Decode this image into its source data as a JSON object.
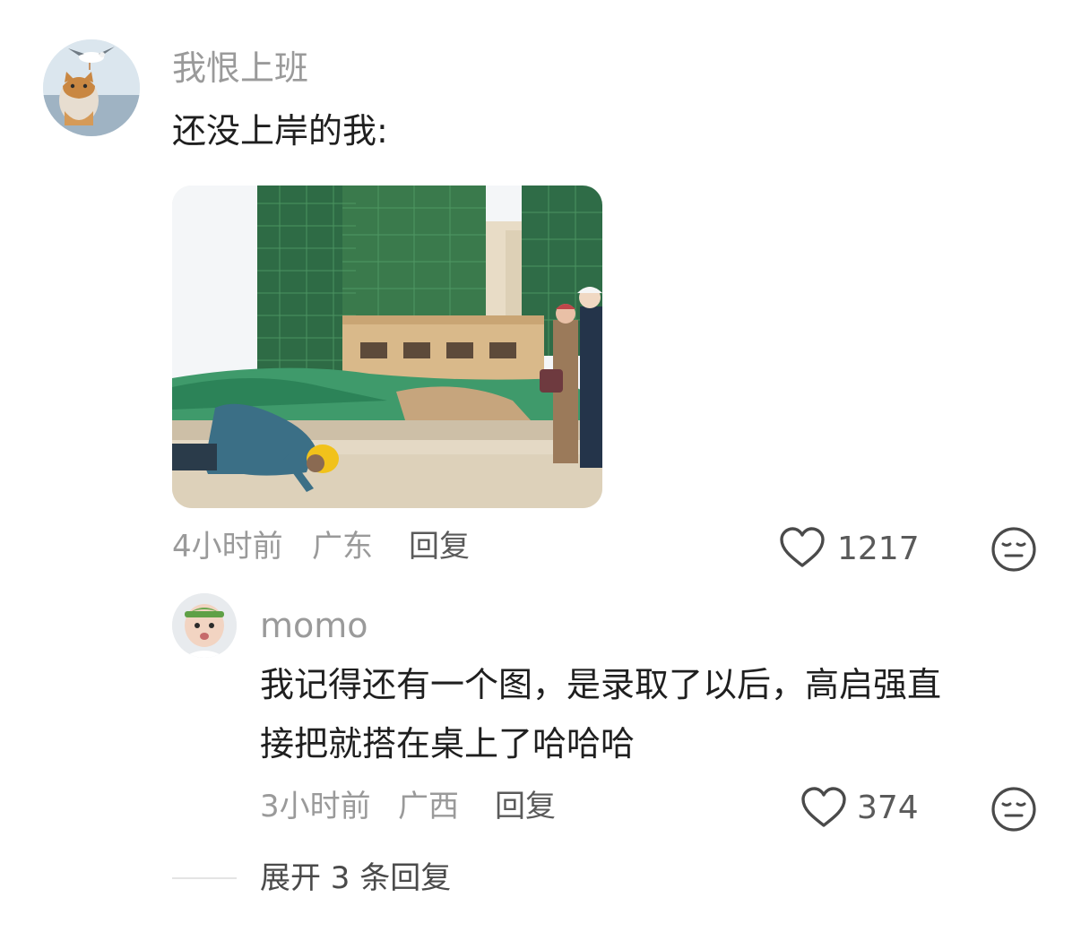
{
  "comment": {
    "username": "我恨上班",
    "text": "还没上岸的我:",
    "time": "4小时前",
    "location": "广东",
    "reply_label": "回复",
    "likes": "1217",
    "image": "construction-worker-kneeling-photo"
  },
  "reply": {
    "username": "momo",
    "text_line1": "我记得还有一个图，是录取了以后，高启强直",
    "text_line2": "接把就搭在桌上了哈哈哈",
    "time": "3小时前",
    "location": "广西",
    "reply_label": "回复",
    "likes": "374"
  },
  "expand_label": "展开 3 条回复",
  "icons": {
    "like": "heart-outline-icon",
    "dislike": "meh-face-icon"
  },
  "colors": {
    "username": "#9a9a9a",
    "text": "#1f1f1f",
    "meta": "#9a9a9a"
  }
}
